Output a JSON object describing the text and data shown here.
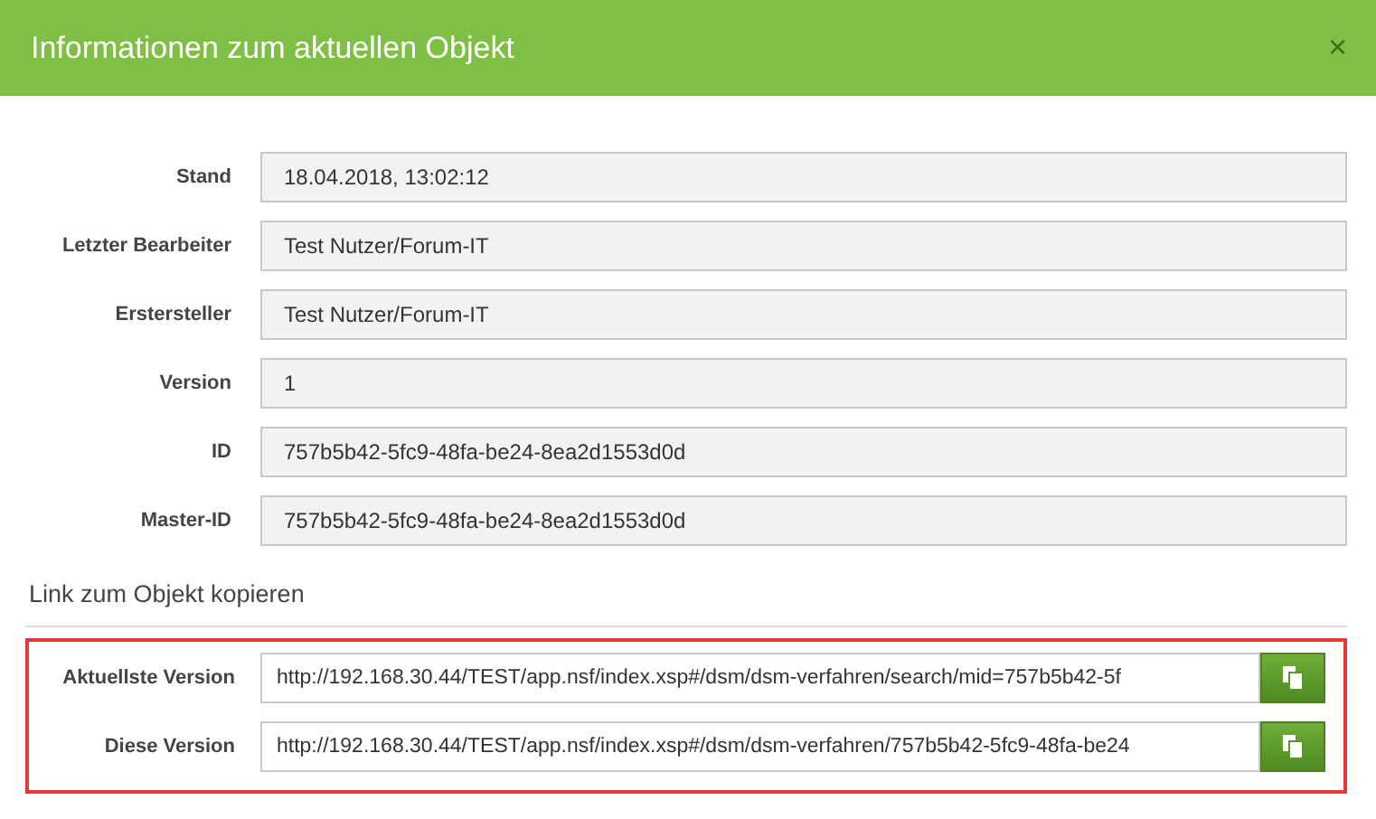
{
  "dialog": {
    "title": "Informationen zum aktuellen Objekt",
    "close": "×"
  },
  "fields": [
    {
      "label": "Stand",
      "value": "18.04.2018, 13:02:12"
    },
    {
      "label": "Letzter Bearbeiter",
      "value": "Test Nutzer/Forum-IT"
    },
    {
      "label": "Erstersteller",
      "value": "Test Nutzer/Forum-IT"
    },
    {
      "label": "Version",
      "value": "1"
    },
    {
      "label": "ID",
      "value": "757b5b42-5fc9-48fa-be24-8ea2d1553d0d"
    },
    {
      "label": "Master-ID",
      "value": "757b5b42-5fc9-48fa-be24-8ea2d1553d0d"
    }
  ],
  "link_section": {
    "title": "Link zum Objekt kopieren",
    "highlighted": true,
    "links": [
      {
        "label": "Aktuellste Version",
        "value": "http://192.168.30.44/TEST/app.nsf/index.xsp#/dsm/dsm-verfahren/search/mid=757b5b42-5f"
      },
      {
        "label": "Diese Version",
        "value": "http://192.168.30.44/TEST/app.nsf/index.xsp#/dsm/dsm-verfahren/757b5b42-5fc9-48fa-be24"
      }
    ]
  }
}
